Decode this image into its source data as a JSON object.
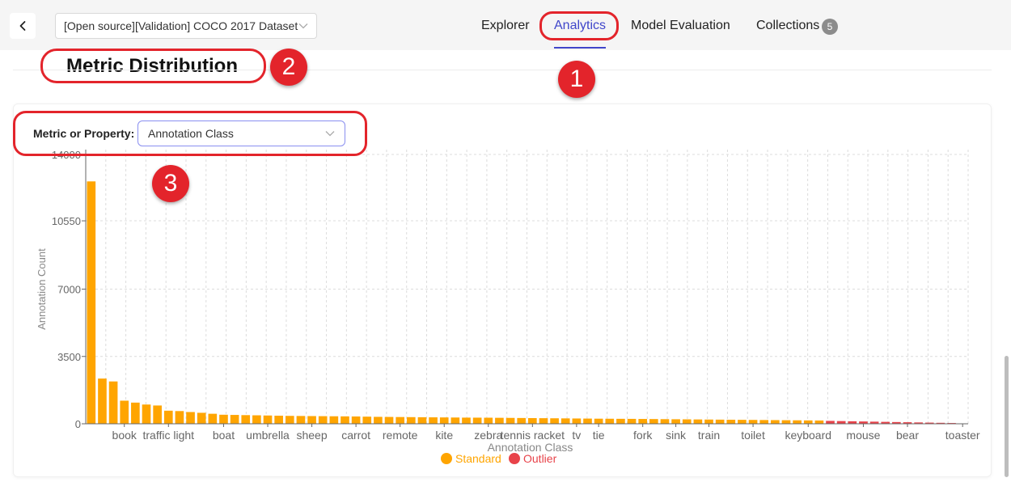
{
  "header": {
    "dataset": "[Open source][Validation] COCO 2017 Dataset",
    "tabs": [
      {
        "label": "Explorer"
      },
      {
        "label": "Analytics"
      },
      {
        "label": "Model Evaluation"
      },
      {
        "label": "Collections"
      }
    ],
    "collections_count": "5"
  },
  "page": {
    "title": "Metric Distribution",
    "metric_label": "Metric or Property:",
    "metric_value": "Annotation Class"
  },
  "annotations": [
    "1",
    "2",
    "3"
  ],
  "colors": {
    "accent": "#4046ca",
    "standard": "#ffa500",
    "outlier": "#e8434a",
    "annotation": "#e3242b"
  },
  "chart_data": {
    "type": "bar",
    "xlabel": "Annotation Class",
    "ylabel": "Annotation Count",
    "ylim": [
      0,
      14000
    ],
    "yticks": [
      "0",
      "3500",
      "7000",
      "10550",
      "14000"
    ],
    "ytick_values": [
      0,
      3500,
      7000,
      10550,
      14000
    ],
    "grid": true,
    "legend": [
      {
        "name": "Standard",
        "color": "#ffa500"
      },
      {
        "name": "Outlier",
        "color": "#e8434a"
      }
    ],
    "legend_position": "bottom-center",
    "category_labels": [
      {
        "index": 3,
        "label": "book"
      },
      {
        "index": 7,
        "label": "traffic light"
      },
      {
        "index": 12,
        "label": "boat"
      },
      {
        "index": 16,
        "label": "umbrella"
      },
      {
        "index": 20,
        "label": "sheep"
      },
      {
        "index": 24,
        "label": "carrot"
      },
      {
        "index": 28,
        "label": "remote"
      },
      {
        "index": 32,
        "label": "kite"
      },
      {
        "index": 36,
        "label": "zebra"
      },
      {
        "index": 40,
        "label": "tennis racket"
      },
      {
        "index": 44,
        "label": "tv"
      },
      {
        "index": 46,
        "label": "tie"
      },
      {
        "index": 50,
        "label": "fork"
      },
      {
        "index": 53,
        "label": "sink"
      },
      {
        "index": 56,
        "label": "train"
      },
      {
        "index": 60,
        "label": "toilet"
      },
      {
        "index": 65,
        "label": "keyboard"
      },
      {
        "index": 70,
        "label": "mouse"
      },
      {
        "index": 74,
        "label": "bear"
      },
      {
        "index": 79,
        "label": "toaster"
      }
    ],
    "series": [
      {
        "name": "Standard",
        "values": [
          12600,
          2350,
          2200,
          1200,
          1100,
          1000,
          950,
          680,
          660,
          610,
          570,
          520,
          470,
          460,
          450,
          440,
          430,
          420,
          410,
          405,
          400,
          395,
          390,
          385,
          380,
          370,
          360,
          355,
          350,
          345,
          340,
          335,
          330,
          325,
          320,
          318,
          315,
          310,
          305,
          300,
          295,
          290,
          285,
          280,
          275,
          270,
          265,
          262,
          258,
          255,
          250,
          245,
          240,
          235,
          230,
          225,
          220,
          215,
          210,
          205,
          200,
          195,
          190,
          185,
          180,
          175,
          170
        ]
      },
      {
        "name": "Outlier",
        "values": [
          150,
          140,
          130,
          120,
          110,
          100,
          90,
          80,
          70,
          60,
          50,
          40,
          20
        ]
      }
    ]
  }
}
